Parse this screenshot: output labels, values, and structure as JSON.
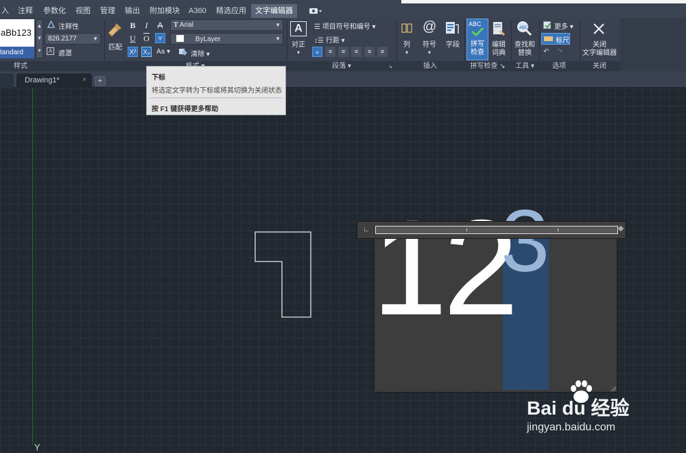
{
  "menu": {
    "tabs": [
      {
        "label": "入"
      },
      {
        "label": "注释"
      },
      {
        "label": "参数化"
      },
      {
        "label": "视图"
      },
      {
        "label": "管理"
      },
      {
        "label": "输出"
      },
      {
        "label": "附加模块"
      },
      {
        "label": "A360"
      },
      {
        "label": "精选应用"
      },
      {
        "label": "文字编辑器",
        "active": true
      }
    ]
  },
  "ribbon": {
    "style": {
      "preview_text": "aBb123",
      "style_name": "tandard",
      "annotative_label": "注释性",
      "height_value": "826.2177",
      "mask_label": "遮罩",
      "panel_title": "样式"
    },
    "format": {
      "match_label": "匹配",
      "font_value": "Arial",
      "color_value": "ByLayer",
      "clear_label": "清除",
      "case_label": "Aa",
      "panel_title": "格式"
    },
    "paragraph": {
      "justify_label": "对正",
      "bullets_label": "项目符号和编号",
      "linespacing_label": "行距",
      "panel_title": "段落"
    },
    "insert": {
      "columns_label": "列",
      "symbol_label": "符号",
      "field_label": "字段",
      "panel_title": "插入"
    },
    "spell": {
      "spellcheck_label1": "拼写",
      "spellcheck_label2": "检查",
      "dict_label1": "编辑",
      "dict_label2": "词典",
      "abc": "ABC",
      "panel_title": "拼写检查"
    },
    "tools": {
      "find_label1": "查找和",
      "find_label2": "替换",
      "panel_title": "工具"
    },
    "options": {
      "more_label": "更多",
      "ruler_label": "标尺",
      "panel_title": "选项"
    },
    "close": {
      "close_label1": "关闭",
      "close_label2": "文字编辑器",
      "panel_title": "关闭"
    }
  },
  "filetabs": {
    "tab_label": "Drawing1*",
    "close_glyph": "×",
    "plus_glyph": "+"
  },
  "tooltip": {
    "title": "下标",
    "description": "将选定文字转为下标或将其切换为关闭状态",
    "help": "按 F1 键获得更多帮助"
  },
  "editor": {
    "main_text": "12",
    "superscript_text": "3"
  },
  "canvas": {
    "y_label": "Y"
  },
  "watermark": {
    "brand": "Bai du 经验",
    "url": "jingyan.baidu.com"
  },
  "colors": {
    "ribbon_bg": "#3a4150",
    "canvas_bg": "#212830",
    "active_tab": "#5a6678",
    "highlight": "#2a4a6f",
    "accent_blue": "#3572b8"
  }
}
